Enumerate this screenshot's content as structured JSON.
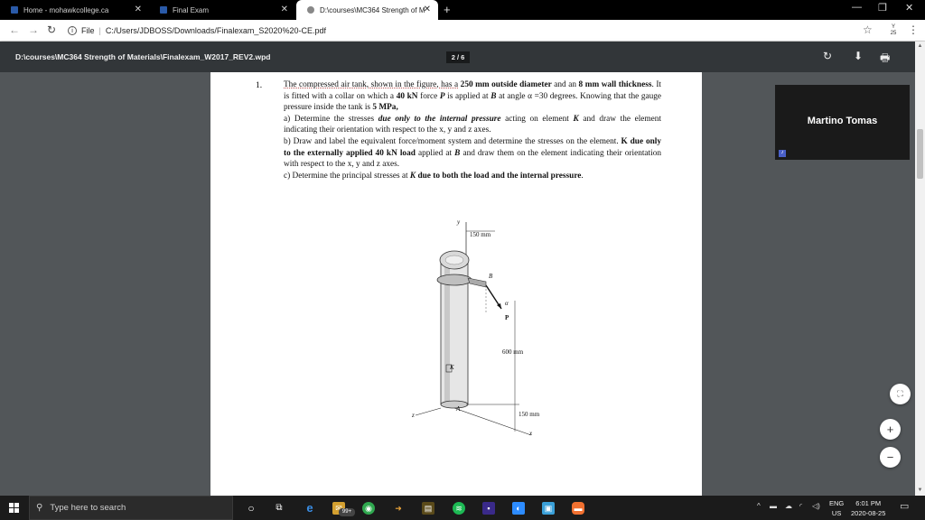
{
  "browser": {
    "tabs": [
      {
        "title": "Home - mohawkcollege.ca",
        "favicon_color": "#2a5aa8",
        "active": false
      },
      {
        "title": "Final Exam",
        "favicon_color": "#2a5aa8",
        "active": false
      },
      {
        "title": "D:\\courses\\MC364 Strength of M",
        "favicon_color": "#888888",
        "active": true
      }
    ],
    "new_tab": "+",
    "window_controls": {
      "minimize": "—",
      "maximize": "❐",
      "close": "✕"
    },
    "address": {
      "scheme": "File",
      "path": "C:/Users/JDBOSS/Downloads/Finalexam_S2020%20-CE.pdf"
    },
    "extension_label": "Y\n25"
  },
  "pdf": {
    "title": "D:\\courses\\MC364 Strength of Materials\\Finalexam_W2017_REV2.wpd",
    "page_indicator": "2 / 6",
    "question": {
      "number": "1.",
      "intro_1": "The compressed air tank, shown in the figure, has a",
      "diameter": "250 mm outside diameter",
      "and_a": "and an",
      "wall": "8 mm wall thickness",
      "intro_2": ". It is fitted with a collar on which a",
      "force": "40 kN",
      "intro_3": "force",
      "P": "P",
      "intro_4": "is applied at",
      "B": "B",
      "intro_5": "at angle α =30 degrees. Knowing that the gauge pressure inside the tank is",
      "pressure": "5 MPa",
      "part_a_1": "a) Determine the stresses",
      "part_a_2": "due only to the internal pressure",
      "part_a_3": "acting on element",
      "K": "K",
      "part_a_4": "and draw the element indicating their orientation with respect to the x, y and z axes.",
      "part_b_1": "b) Draw and label the equivalent force/moment system and determine the stresses on the element.",
      "part_b_2": "K due only to the externally applied 40 kN load",
      "part_b_3": "applied at",
      "part_b_4": "and draw them on the element indicating their orientation with respect to the x, y and z axes.",
      "part_c_1": "c) Determine the principal stresses at",
      "part_c_2": "due to both the load and the internal pressure",
      "part_c_3": "."
    },
    "figure": {
      "dim_top": "150 mm",
      "dim_mid": "600 mm",
      "dim_bottom": "150 mm",
      "label_y": "y",
      "label_x": "x",
      "label_z": "z",
      "label_B": "B",
      "label_P": "P",
      "label_alpha": "α",
      "label_K": "K",
      "label_A": "A"
    }
  },
  "meeting": {
    "participant": "Martino Tomas"
  },
  "taskbar": {
    "search_placeholder": "Type here to search",
    "badge": "99+",
    "lang_top": "ENG",
    "lang_bottom": "US",
    "time": "6:01 PM",
    "date": "2020-08-25"
  }
}
